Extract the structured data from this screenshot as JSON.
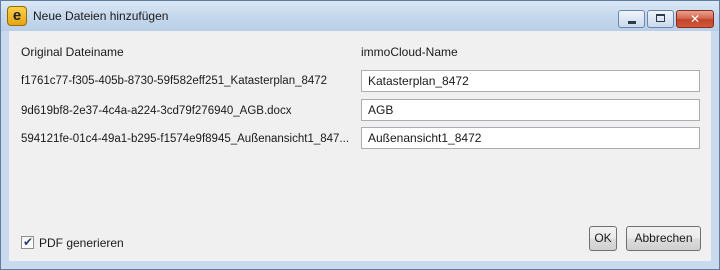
{
  "window": {
    "title": "Neue Dateien hinzufügen",
    "app_icon_letter": "e",
    "controls": {
      "minimize": "minimize-icon",
      "maximize": "maximize-icon",
      "close": "close-icon",
      "close_glyph": "✕"
    }
  },
  "columns": {
    "original": "Original Dateiname",
    "cloud": "immoCloud-Name"
  },
  "files": [
    {
      "original": "f1761c77-f305-405b-8730-59f582eff251_Katasterplan_8472",
      "cloud_name": "Katasterplan_8472"
    },
    {
      "original": "9d619bf8-2e37-4c4a-a224-3cd79f276940_AGB.docx",
      "cloud_name": "AGB"
    },
    {
      "original": "594121fe-01c4-49a1-b295-f1574e9f8945_Außenansicht1_847...",
      "cloud_name": "Außenansicht1_8472"
    }
  ],
  "options": {
    "pdf_label": "PDF generieren",
    "pdf_checked": true,
    "check_glyph": "✔"
  },
  "buttons": {
    "ok": "OK",
    "cancel": "Abbrechen"
  }
}
